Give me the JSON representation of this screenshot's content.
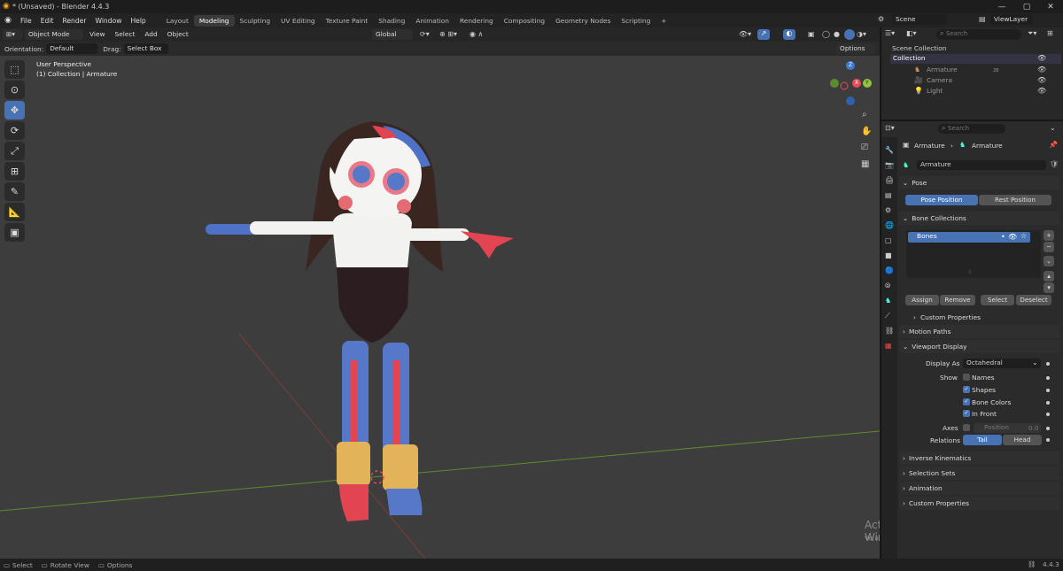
{
  "window": {
    "title": "* (Unsaved) - Blender 4.4.3",
    "min": "—",
    "max": "▢",
    "close": "✕"
  },
  "menus": [
    "File",
    "Edit",
    "Render",
    "Window",
    "Help"
  ],
  "workspaces": [
    "Layout",
    "Modeling",
    "Sculpting",
    "UV Editing",
    "Texture Paint",
    "Shading",
    "Animation",
    "Rendering",
    "Compositing",
    "Geometry Nodes",
    "Scripting"
  ],
  "active_workspace": "Modeling",
  "scene": {
    "name": "Scene",
    "view_layer": "ViewLayer"
  },
  "viewport": {
    "mode": "Object Mode",
    "menu": [
      "View",
      "Select",
      "Add",
      "Object"
    ],
    "transform": "Global",
    "orientation_label": "Orientation:",
    "orientation_value": "Default",
    "drag_label": "Drag:",
    "drag_value": "Select Box",
    "options": "Options",
    "perspective": "User Perspective",
    "context": "(1) Collection | Armature",
    "search_placeholder": "Search"
  },
  "axes": {
    "x": "X",
    "y": "Y",
    "z": "Z"
  },
  "outliner": {
    "root": "Scene Collection",
    "collection": "Collection",
    "items": [
      "Armature",
      "Camera",
      "Light"
    ],
    "armature_count": "28"
  },
  "properties": {
    "search_placeholder": "Search",
    "breadcrumb_a": "Armature",
    "breadcrumb_b": "Armature",
    "data_name": "Armature",
    "pose": "Pose",
    "pose_position": "Pose Position",
    "rest_position": "Rest Position",
    "bone_collections": "Bone Collections",
    "bones_item": "Bones",
    "assign": "Assign",
    "remove": "Remove",
    "select": "Select",
    "deselect": "Deselect",
    "custom_properties_sub": "Custom Properties",
    "motion_paths": "Motion Paths",
    "viewport_display": "Viewport Display",
    "display_as_label": "Display As",
    "display_as_value": "Octahedral",
    "show_label": "Show",
    "names": "Names",
    "shapes": "Shapes",
    "bone_colors": "Bone Colors",
    "in_front": "In Front",
    "axes_label": "Axes",
    "position": "Position",
    "position_value": "0.0",
    "relations_label": "Relations",
    "tail": "Tail",
    "head": "Head",
    "inverse_kinematics": "Inverse Kinematics",
    "selection_sets": "Selection Sets",
    "animation": "Animation",
    "custom_properties": "Custom Properties"
  },
  "watermark": {
    "line1": "Activar Windows",
    "line2": "Ve a Configuración para activar Windows."
  },
  "status": {
    "select": "Select",
    "rotate": "Rotate View",
    "options": "Options",
    "version": "4.4.3"
  },
  "colors": {
    "accent": "#4772b3",
    "viewport": "#3d3d3d",
    "x_axis": "#e84b5a",
    "y_axis": "#8ec63c",
    "z_axis": "#3e7ad6"
  }
}
